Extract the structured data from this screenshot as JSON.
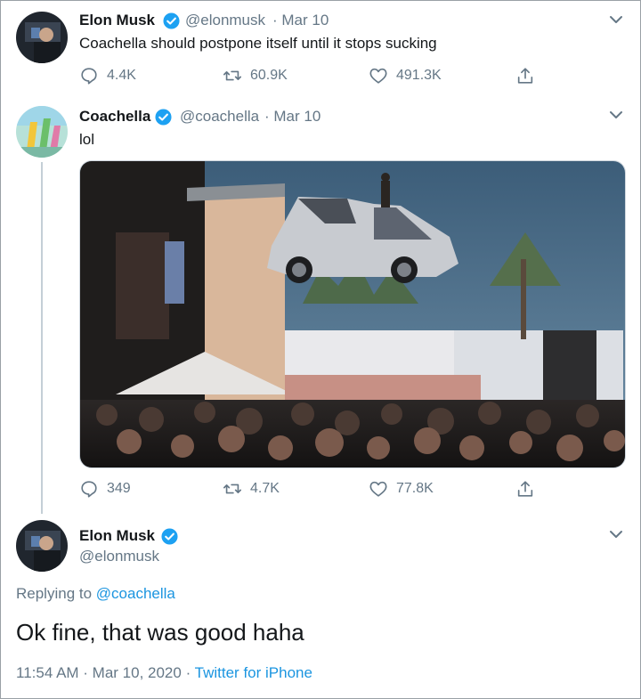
{
  "tweets": [
    {
      "author_name": "Elon Musk",
      "handle": "@elonmusk",
      "date": "· Mar 10",
      "text": "Coachella should postpone itself until it stops sucking",
      "replies": "4.4K",
      "retweets": "60.9K",
      "likes": "491.3K"
    },
    {
      "author_name": "Coachella",
      "handle": "@coachella",
      "date": "· Mar 10",
      "text": "lol",
      "replies": "349",
      "retweets": "4.7K",
      "likes": "77.8K"
    }
  ],
  "main_tweet": {
    "author_name": "Elon Musk",
    "handle": "@elonmusk",
    "replying_prefix": "Replying to",
    "replying_handle": "@coachella",
    "text": "Ok fine, that was good haha",
    "timestamp": "11:54 AM · Mar 10, 2020 ·",
    "source": "Twitter for iPhone"
  },
  "icons": [
    "verified-badge-icon",
    "chevron-down-icon",
    "reply-icon",
    "retweet-icon",
    "like-icon",
    "share-icon"
  ],
  "colors": {
    "verified": "#1da1f2",
    "link": "#1b95e0",
    "muted": "#657786",
    "text": "#14171a"
  }
}
